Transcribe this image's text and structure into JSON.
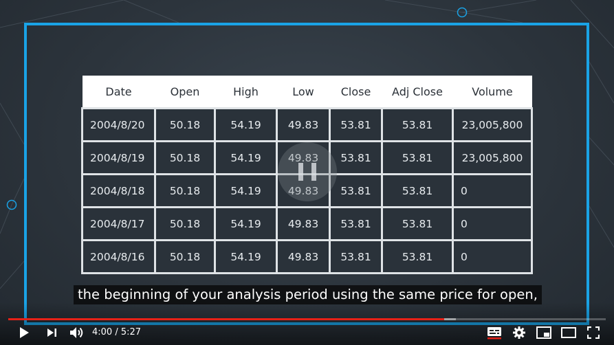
{
  "table": {
    "headers": [
      "Date",
      "Open",
      "High",
      "Low",
      "Close",
      "Adj Close",
      "Volume"
    ],
    "rows": [
      [
        "2004/8/20",
        "50.18",
        "54.19",
        "49.83",
        "53.81",
        "53.81",
        "23,005,800"
      ],
      [
        "2004/8/19",
        "50.18",
        "54.19",
        "49.83",
        "53.81",
        "53.81",
        "23,005,800"
      ],
      [
        "2004/8/18",
        "50.18",
        "54.19",
        "49.83",
        "53.81",
        "53.81",
        "0"
      ],
      [
        "2004/8/17",
        "50.18",
        "54.19",
        "49.83",
        "53.81",
        "53.81",
        "0"
      ],
      [
        "2004/8/16",
        "50.18",
        "54.19",
        "49.83",
        "53.81",
        "53.81",
        "0"
      ]
    ]
  },
  "caption": "the beginning of your analysis period using the same price for open,",
  "player": {
    "current_time": "4:00",
    "separator": " / ",
    "duration": "5:27",
    "progress_fraction": 0.73,
    "loaded_fraction": 0.75,
    "accent_color": "#e62117",
    "frame_color": "#1aa3e6"
  },
  "icons": {
    "play": "play-icon",
    "next": "next-icon",
    "volume": "volume-icon",
    "subtitles": "subtitles-icon",
    "settings": "gear-icon",
    "miniplayer": "miniplayer-icon",
    "theater": "theater-icon",
    "fullscreen": "fullscreen-icon"
  }
}
